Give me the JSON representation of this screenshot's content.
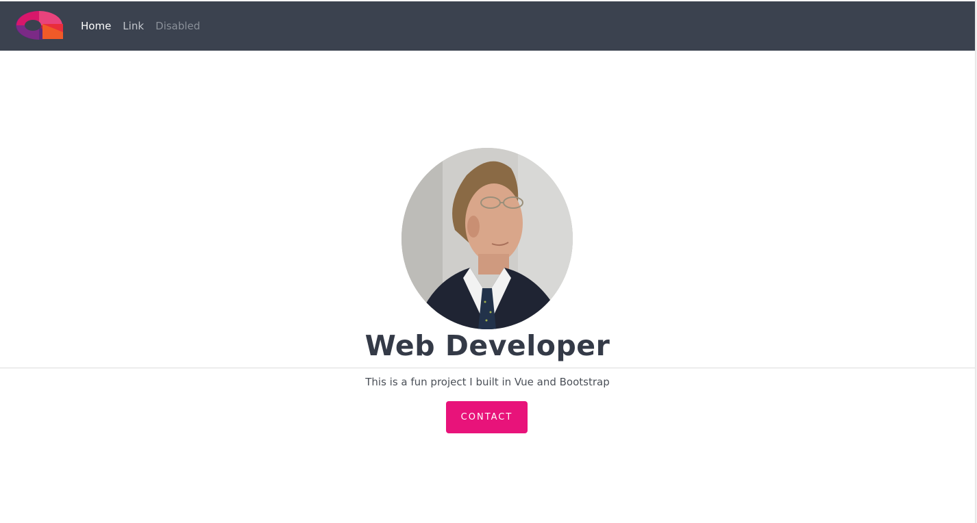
{
  "navbar": {
    "logo_icon": "brand-logo-icon",
    "links": [
      {
        "label": "Home",
        "state": "active"
      },
      {
        "label": "Link",
        "state": "normal"
      },
      {
        "label": "Disabled",
        "state": "disabled"
      }
    ]
  },
  "hero": {
    "profile_image": "profile-photo",
    "title": "Web Developer",
    "subtitle": "This is a fun project I built in Vue and Bootstrap",
    "contact_label": "CONTACT"
  },
  "colors": {
    "navbar_bg": "#3b424f",
    "accent": "#e8137a",
    "title_text": "#343a47"
  }
}
